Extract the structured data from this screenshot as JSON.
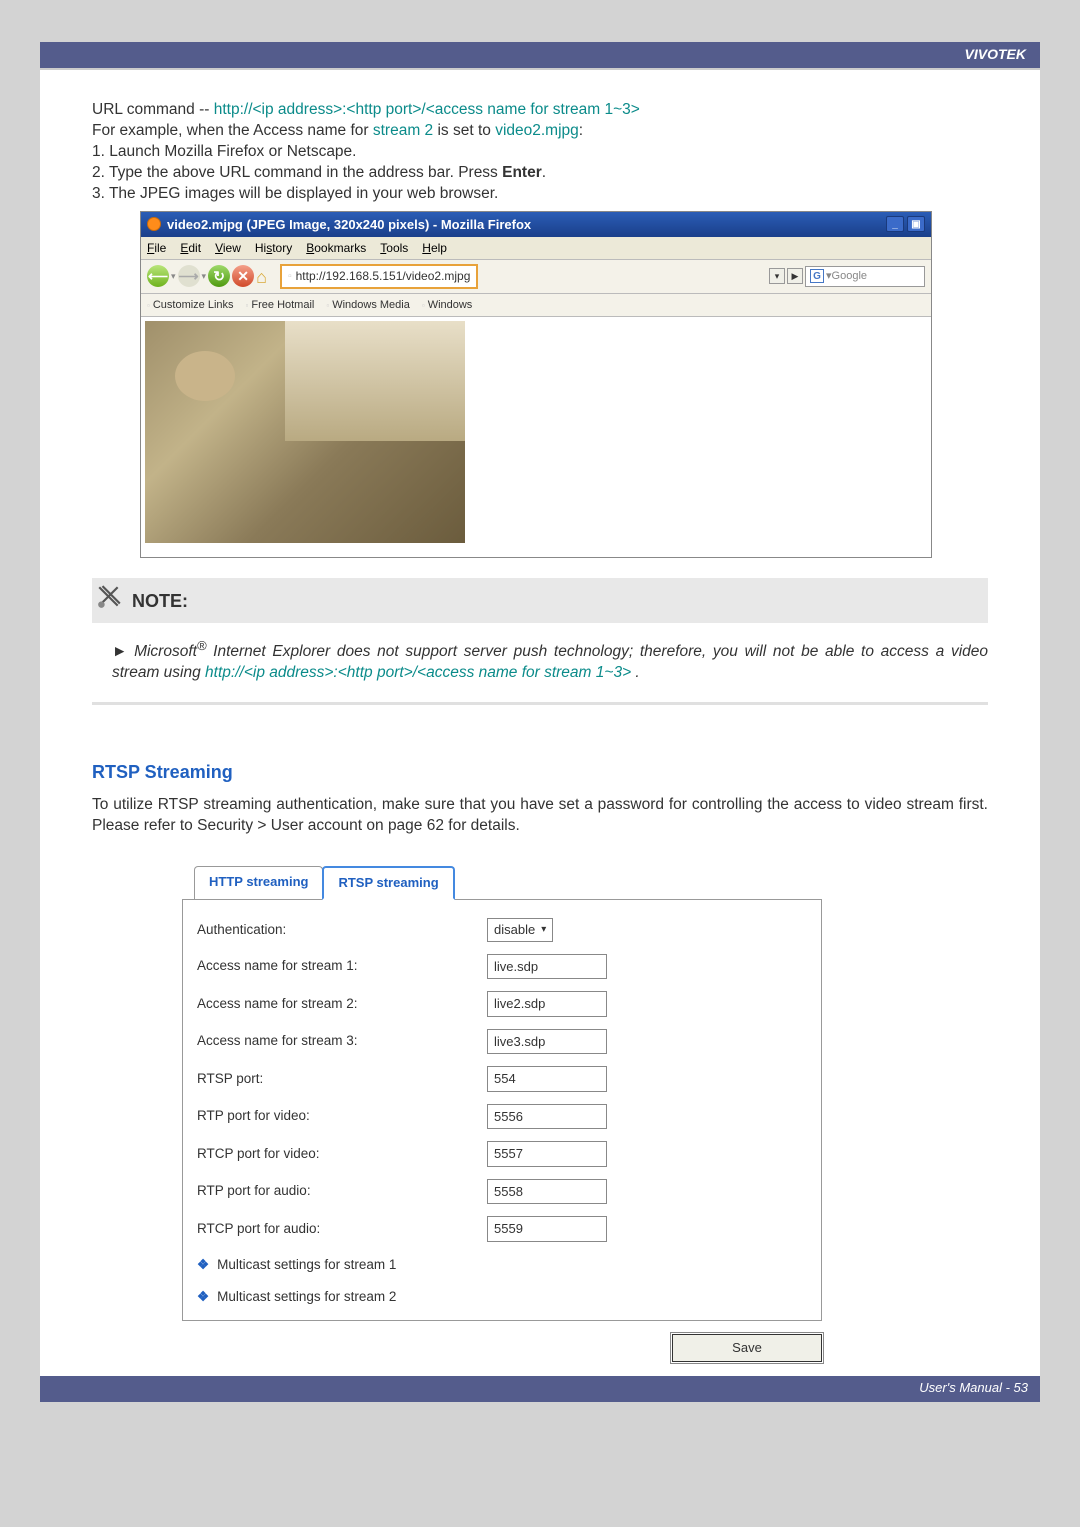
{
  "brand": "VIVOTEK",
  "footer": "User's Manual - 53",
  "intro": {
    "url_command_prefix": "URL command -- ",
    "url_command": "http://<ip address>:<http port>/<access name for stream 1~3>",
    "example_prefix": "For example, when the Access name for ",
    "stream2": "stream 2",
    "example_mid": " is set to ",
    "video2": "video2.mjpg",
    "example_suffix": ":",
    "step1": "1. Launch Mozilla Firefox or Netscape.",
    "step2_prefix": "2. Type the above URL command in the address bar. Press ",
    "step2_bold": "Enter",
    "step2_suffix": ".",
    "step3": "3. The JPEG images will be displayed in your web browser."
  },
  "browser": {
    "title": "video2.mjpg (JPEG Image, 320x240 pixels) - Mozilla Firefox",
    "menus": [
      "File",
      "Edit",
      "View",
      "History",
      "Bookmarks",
      "Tools",
      "Help"
    ],
    "address": "http://192.168.5.151/video2.mjpg",
    "search_placeholder": "Google",
    "bookmarks": [
      "Customize Links",
      "Free Hotmail",
      "Windows Media",
      "Windows"
    ]
  },
  "note": {
    "title": "NOTE:",
    "arrow": "►",
    "line1_prefix": "Microsoft",
    "line1_reg": "®",
    "line1_rest": " Internet Explorer does not support server push technology; therefore, you will not be able to access a video stream using ",
    "line1_url": "http://<ip address>:<http port>/<access name for stream 1~3>",
    "line1_end": " ."
  },
  "rtsp": {
    "title": "RTSP Streaming",
    "text": "To utilize RTSP streaming authentication, make sure that you have set a password for controlling the access to video stream first. Please refer to Security > User account on page 62 for details.",
    "tabs": {
      "http": "HTTP streaming",
      "rtsp": "RTSP streaming"
    },
    "form": {
      "auth_label": "Authentication:",
      "auth_value": "disable",
      "s1_label": "Access name for stream 1:",
      "s1_value": "live.sdp",
      "s2_label": "Access name for stream 2:",
      "s2_value": "live2.sdp",
      "s3_label": "Access name for stream 3:",
      "s3_value": "live3.sdp",
      "rtsp_port_label": "RTSP port:",
      "rtsp_port_value": "554",
      "rtp_video_label": "RTP port for video:",
      "rtp_video_value": "5556",
      "rtcp_video_label": "RTCP port for video:",
      "rtcp_video_value": "5557",
      "rtp_audio_label": "RTP port for audio:",
      "rtp_audio_value": "5558",
      "rtcp_audio_label": "RTCP port for audio:",
      "rtcp_audio_value": "5559",
      "multicast1": "Multicast settings for stream 1",
      "multicast2": "Multicast settings for stream 2",
      "save": "Save"
    }
  }
}
